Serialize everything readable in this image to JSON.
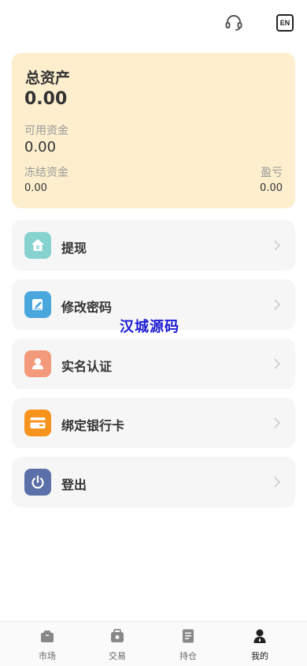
{
  "header": {
    "support_icon": "headset-icon",
    "language_label": "EN"
  },
  "assets": {
    "title": "总资产",
    "total": "0.00",
    "available_label": "可用资金",
    "available_value": "0.00",
    "frozen_label": "冻结资金",
    "frozen_value": "0.00",
    "profit_loss_label": "盈亏",
    "profit_loss_value": "0.00"
  },
  "menu": [
    {
      "label": "提现",
      "icon": "withdraw-icon",
      "color": "#86d2cf"
    },
    {
      "label": "修改密码",
      "icon": "edit-password-icon",
      "color": "#4aa7de"
    },
    {
      "label": "实名认证",
      "icon": "user-verify-icon",
      "color": "#f39a7c"
    },
    {
      "label": "绑定银行卡",
      "icon": "bank-card-icon",
      "color": "#f7941d"
    },
    {
      "label": "登出",
      "icon": "power-icon",
      "color": "#5b6fa8"
    }
  ],
  "watermark": "汉城源码",
  "tabbar": {
    "items": [
      {
        "label": "市场",
        "icon": "market-icon"
      },
      {
        "label": "交易",
        "icon": "trade-icon"
      },
      {
        "label": "持仓",
        "icon": "holdings-icon"
      },
      {
        "label": "我的",
        "icon": "profile-icon",
        "active": true
      }
    ]
  },
  "colors": {
    "card_bg": "#fdefce",
    "menu_bg": "#f6f6f6",
    "watermark": "#1a1ad6"
  }
}
